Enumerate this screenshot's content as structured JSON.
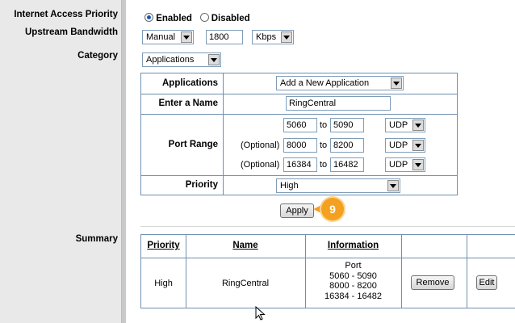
{
  "sidebar": {
    "internet_access_priority": "Internet Access Priority",
    "upstream_bandwidth": "Upstream Bandwidth",
    "category": "Category",
    "summary": "Summary"
  },
  "access_priority": {
    "enabled_label": "Enabled",
    "disabled_label": "Disabled",
    "selected": "Enabled"
  },
  "bandwidth": {
    "mode": "Manual",
    "value": "1800",
    "unit": "Kbps"
  },
  "category_select": "Applications",
  "form": {
    "applications_label": "Applications",
    "applications_value": "Add a New Application",
    "name_label": "Enter a Name",
    "name_value": "RingCentral",
    "port_range_label": "Port Range",
    "optional_label": "(Optional)",
    "to_label": "to",
    "ports": [
      {
        "start": "5060",
        "end": "5090",
        "protocol": "UDP"
      },
      {
        "start": "8000",
        "end": "8200",
        "protocol": "UDP"
      },
      {
        "start": "16384",
        "end": "16482",
        "protocol": "UDP"
      }
    ],
    "priority_label": "Priority",
    "priority_value": "High",
    "apply_label": "Apply"
  },
  "step_badge": "9",
  "summary_table": {
    "headers": [
      "Priority",
      "Name",
      "Information"
    ],
    "row": {
      "priority": "High",
      "name": "RingCentral",
      "info": [
        "Port",
        "5060 - 5090",
        "8000 - 8200",
        "16384 - 16482"
      ],
      "remove_label": "Remove",
      "edit_label": "Edit"
    }
  },
  "colors": {
    "border_blue": "#6f8fb0",
    "badge_orange": "#f4a020",
    "sidebar_gray": "#e9e9e9"
  }
}
